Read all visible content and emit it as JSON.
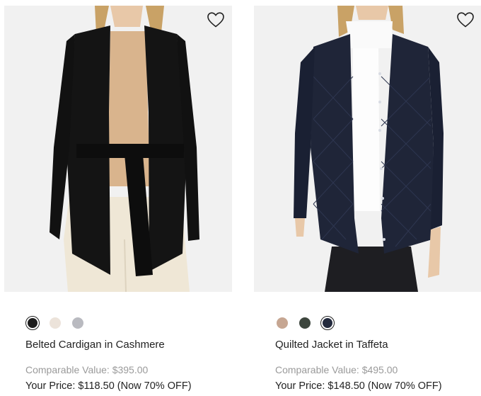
{
  "products": [
    {
      "name": "Belted Cardigan in Cashmere",
      "comparable_value": "Comparable Value: $395.00",
      "your_price": "Your Price: $118.50 (Now 70% OFF)",
      "image_alt": "Model wearing black belted cashmere cardigan over beige top and cream trousers",
      "wishlist_icon": "heart-outline-icon",
      "swatches": [
        {
          "color": "#1b1b1b",
          "selected": true
        },
        {
          "color": "#ece3da",
          "selected": false
        },
        {
          "color": "#b9bac0",
          "selected": false
        }
      ]
    },
    {
      "name": "Quilted Jacket in Taffeta",
      "comparable_value": "Comparable Value: $495.00",
      "your_price": "Your Price: $148.50 (Now 70% OFF)",
      "image_alt": "Model wearing navy quilted taffeta jacket over white turtleneck and black trousers",
      "wishlist_icon": "heart-outline-icon",
      "swatches": [
        {
          "color": "#c6a692",
          "selected": false
        },
        {
          "color": "#3d463e",
          "selected": false
        },
        {
          "color": "#232a3d",
          "selected": true
        }
      ]
    }
  ]
}
